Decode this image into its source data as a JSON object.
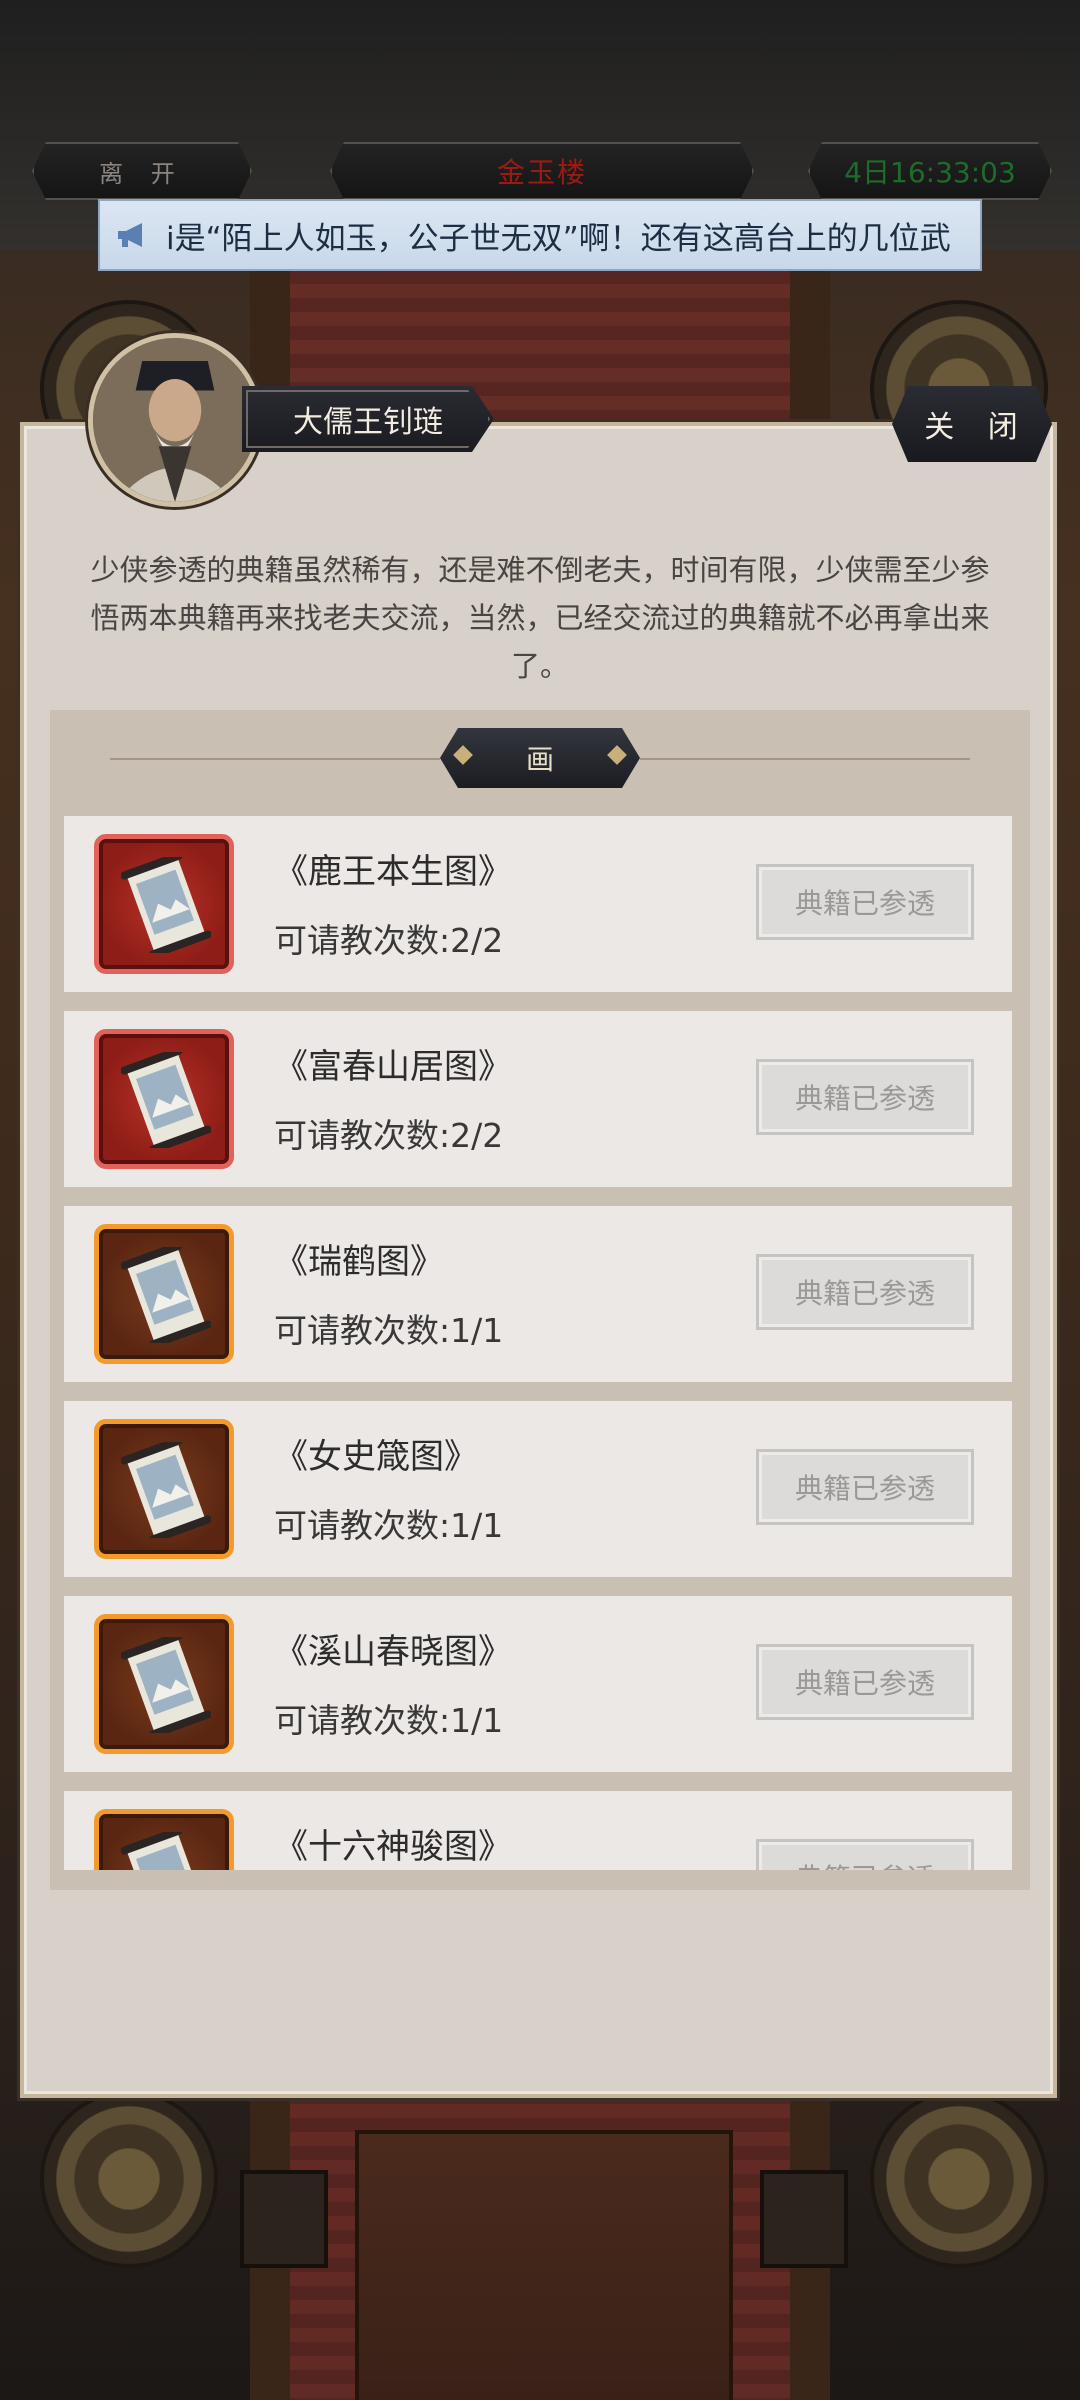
{
  "top_bar": {
    "leave_label": "离 开",
    "venue_title": "金玉楼",
    "timer": "4日16:33:03"
  },
  "marquee": {
    "icon": "megaphone-icon",
    "text": "i是“陌上人如玉，公子世无双”啊！还有这高台上的几位武"
  },
  "dialog": {
    "npc_name": "大儒王钊琏",
    "close_label": "关 闭",
    "intro_text": "少侠参透的典籍虽然稀有，还是难不倒老夫，时间有限，少侠需至少参悟两本典籍再来找老夫交流，当然，已经交流过的典籍就不必再拿出来了。",
    "category_label": "画",
    "items": [
      {
        "title": "《鹿王本生图》",
        "count": "可请教次数:2/2",
        "button": "典籍已参透",
        "rarity": "red"
      },
      {
        "title": "《富春山居图》",
        "count": "可请教次数:2/2",
        "button": "典籍已参透",
        "rarity": "red"
      },
      {
        "title": "《瑞鹤图》",
        "count": "可请教次数:1/1",
        "button": "典籍已参透",
        "rarity": "orange"
      },
      {
        "title": "《女史箴图》",
        "count": "可请教次数:1/1",
        "button": "典籍已参透",
        "rarity": "orange"
      },
      {
        "title": "《溪山春晓图》",
        "count": "可请教次数:1/1",
        "button": "典籍已参透",
        "rarity": "orange"
      },
      {
        "title": "《十六神骏图》",
        "count": "",
        "button": "典籍已参透",
        "rarity": "orange"
      }
    ]
  },
  "colors": {
    "rarity_red_border": "#e0625a",
    "rarity_orange_border": "#f29a2a",
    "venue_title": "#9c1a12",
    "timer": "#1f6b2b"
  }
}
